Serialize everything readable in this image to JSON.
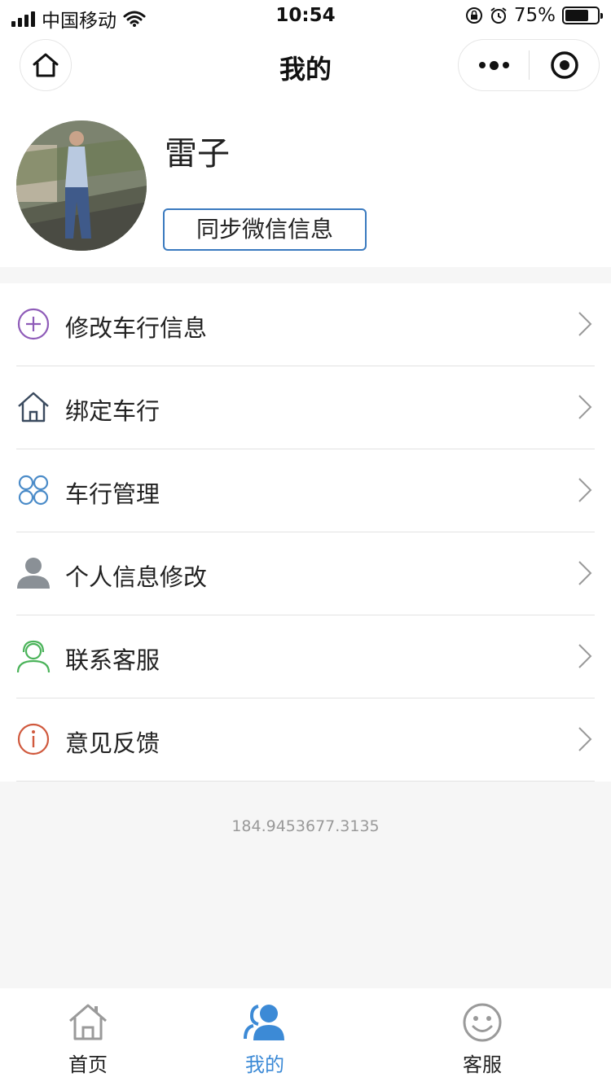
{
  "status_bar": {
    "carrier": "中国移动",
    "time": "10:54",
    "battery_percent": "75%",
    "battery_level": 0.75
  },
  "navbar": {
    "title": "我的"
  },
  "profile": {
    "name": "雷子",
    "sync_button": "同步微信信息"
  },
  "menu": {
    "items": [
      {
        "label": "修改车行信息",
        "icon": "plus-circle-icon",
        "color": "#8e5bb8"
      },
      {
        "label": "绑定车行",
        "icon": "house-icon",
        "color": "#3a4a5e"
      },
      {
        "label": "车行管理",
        "icon": "clover-icon",
        "color": "#4a8bc8"
      },
      {
        "label": "个人信息修改",
        "icon": "person-icon",
        "color": "#8a9096"
      },
      {
        "label": "联系客服",
        "icon": "headset-icon",
        "color": "#4bb35a"
      },
      {
        "label": "意见反馈",
        "icon": "info-circle-icon",
        "color": "#d0593d"
      }
    ]
  },
  "version": "184.9453677.3135",
  "tabbar": {
    "tabs": [
      {
        "label": "首页",
        "icon": "home-icon",
        "active": false
      },
      {
        "label": "我的",
        "icon": "users-icon",
        "active": true
      },
      {
        "label": "客服",
        "icon": "smiley-icon",
        "active": false
      }
    ],
    "active_color": "#3c8ad6",
    "inactive_color": "#9a9a9a"
  }
}
